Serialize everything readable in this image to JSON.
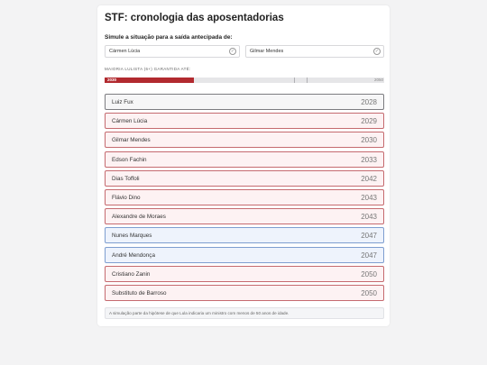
{
  "title": "STF: cronologia das aposentadorias",
  "simulate_label": "Simule a situação para a saída antecipada de:",
  "simulation": [
    {
      "name": "Cármen Lúcia",
      "checked": false
    },
    {
      "name": "Gilmar Mendes",
      "checked": false
    }
  ],
  "majority": {
    "label": "MAIORIA LULISTA (6+) GARANTIDA ATÉ:",
    "year": "2030",
    "end_year": "2050",
    "fill_fraction": 0.32,
    "color": "#b22a2f"
  },
  "justices": [
    {
      "name": "Luiz Fux",
      "year": "2028",
      "style": "neutral"
    },
    {
      "name": "Cármen Lúcia",
      "year": "2029",
      "style": "red"
    },
    {
      "name": "Gilmar Mendes",
      "year": "2030",
      "style": "red"
    },
    {
      "name": "Edson Fachin",
      "year": "2033",
      "style": "red"
    },
    {
      "name": "Dias Toffoli",
      "year": "2042",
      "style": "red"
    },
    {
      "name": "Flávio Dino",
      "year": "2043",
      "style": "red"
    },
    {
      "name": "Alexandre de Moraes",
      "year": "2043",
      "style": "red"
    },
    {
      "name": "Nunes Marques",
      "year": "2047",
      "style": "blue"
    },
    {
      "name": "André Mendonça",
      "year": "2047",
      "style": "blue"
    },
    {
      "name": "Cristiano Zanin",
      "year": "2050",
      "style": "red"
    },
    {
      "name": "Substituto de Barroso",
      "year": "2050",
      "style": "red"
    }
  ],
  "footnote": "A simulação parte da hipótese de que Lula indicaria um ministro com menos de 50 anos de idade.",
  "colors": {
    "red_border": "#c56a6f",
    "blue_border": "#7e9ed0",
    "neutral_border": "#7c7c80"
  }
}
